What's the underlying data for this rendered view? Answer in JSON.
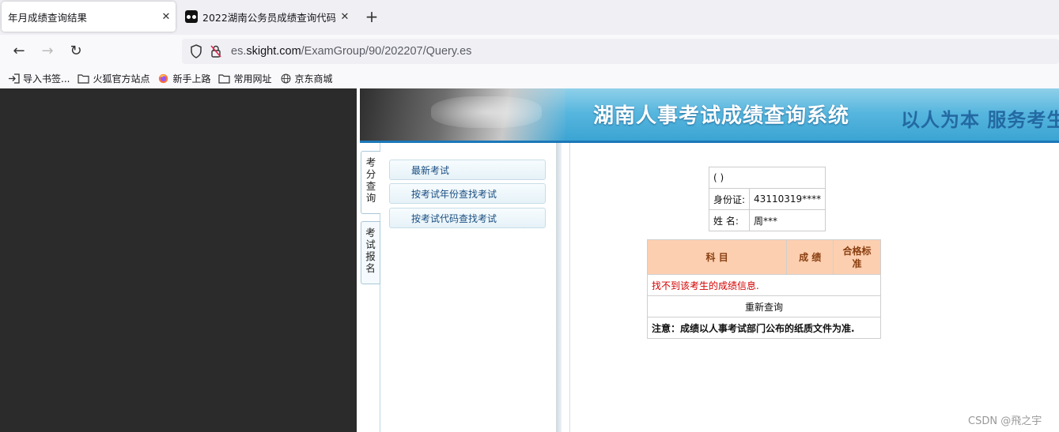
{
  "browser": {
    "tabs": [
      {
        "title": "年月成绩查询结果",
        "close": "✕"
      },
      {
        "title": "2022湖南公务员成绩查询代码",
        "close": "✕"
      }
    ],
    "new_tab": "+",
    "nav": {
      "back": "←",
      "forward": "→",
      "reload": "↻"
    },
    "url": {
      "prefix": "es.",
      "domain": "skight.com",
      "path": "/ExamGroup/90/202207/Query.es"
    },
    "bookmarks": [
      {
        "label": "导入书签...",
        "icon": "import-icon"
      },
      {
        "label": "火狐官方站点",
        "icon": "folder-icon"
      },
      {
        "label": "新手上路",
        "icon": "firefox-icon"
      },
      {
        "label": "常用网址",
        "icon": "folder-icon"
      },
      {
        "label": "京东商城",
        "icon": "globe-icon"
      }
    ]
  },
  "page": {
    "banner": {
      "title": "湖南人事考试成绩查询系统",
      "slogan": "以人为本  服务考生"
    },
    "side_tabs": [
      "考分查询",
      "考试报名"
    ],
    "menu": [
      "最新考试",
      "按考试年份查找考试",
      "按考试代码查找考试"
    ],
    "info": {
      "header": "( )",
      "id_label": "身份证:",
      "id_value": "43110319****",
      "name_label": "姓 名:",
      "name_value": "周***"
    },
    "score_table": {
      "headers": [
        "科 目",
        "成 绩",
        "合格标准"
      ],
      "error": "找不到该考生的成绩信息.",
      "requery": "重新查询",
      "note": "注意：成绩以人事考试部门公布的纸质文件为准."
    },
    "watermark": "CSDN @飛之宇"
  }
}
